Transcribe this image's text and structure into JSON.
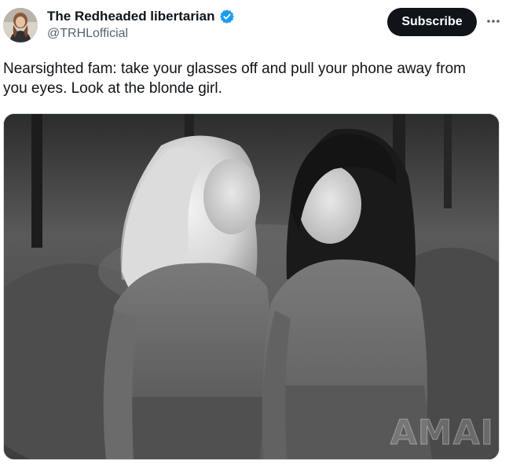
{
  "author": {
    "name": "The Redheaded libertarian",
    "handle": "@TRHLofficial",
    "verified": true,
    "verified_color": "#1d9bf0",
    "avatar_icon": "profile-photo"
  },
  "actions": {
    "subscribe_label": "Subscribe",
    "more_icon": "more-horizontal-icon"
  },
  "tweet": {
    "line1": "Nearsighted fam: take your glasses off and pull your phone away from",
    "line2": "you eyes. Look at the blonde girl."
  },
  "media": {
    "watermark": "AMAI"
  },
  "colors": {
    "text": "#0f1419",
    "secondary_text": "#536471",
    "button_bg": "#0f1419",
    "button_text": "#ffffff"
  }
}
